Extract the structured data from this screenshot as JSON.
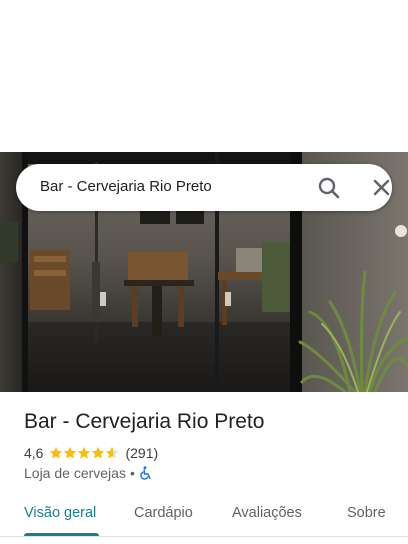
{
  "search": {
    "query": "Bar - Cervejaria Rio Preto",
    "search_icon": "search-icon",
    "close_icon": "close-icon"
  },
  "place": {
    "name": "Bar - Cervejaria Rio Preto",
    "rating": "4,6",
    "rating_value": 4.6,
    "stars_max": 5,
    "reviews": "(291)",
    "category": "Loja de cervejas",
    "separator": "•",
    "accessibility_icon": "wheelchair-icon"
  },
  "tabs": [
    {
      "label": "Visão geral",
      "active": true
    },
    {
      "label": "Cardápio",
      "active": false
    },
    {
      "label": "Avaliações",
      "active": false
    },
    {
      "label": "Sobre",
      "active": false
    }
  ],
  "colors": {
    "accent": "#1a7e8f",
    "star": "#fbbc04",
    "star_empty": "#dadce0",
    "access": "#1a73e8"
  }
}
